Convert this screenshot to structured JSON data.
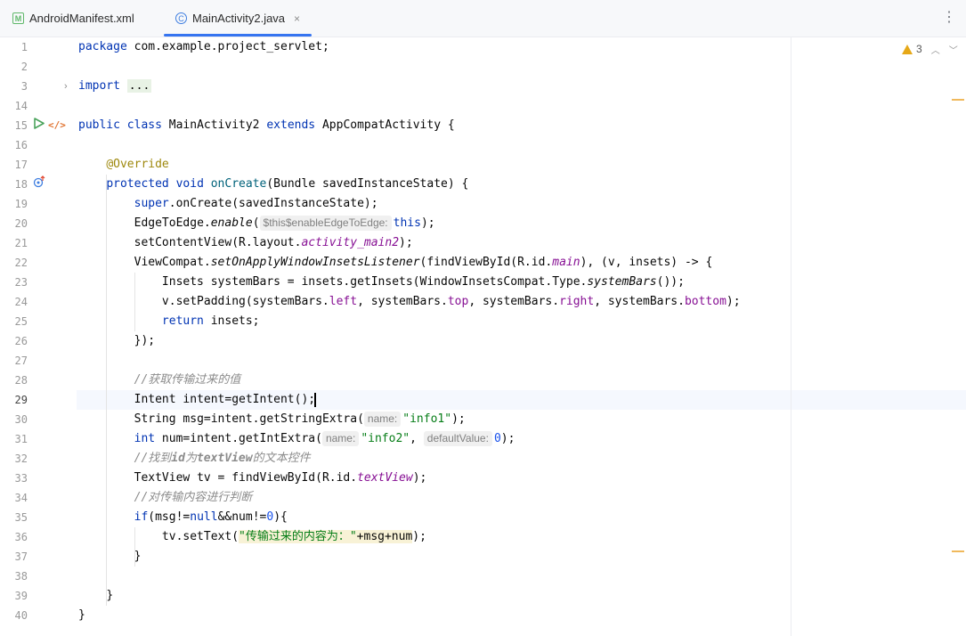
{
  "tabs": [
    {
      "label": "AndroidManifest.xml",
      "icon": "xml-file-icon",
      "active": false
    },
    {
      "label": "MainActivity2.java",
      "icon": "java-class-icon",
      "active": true,
      "close": "×"
    }
  ],
  "menu_glyph": "⋮",
  "inspection": {
    "warning_count": "3"
  },
  "colors": {
    "accent": "#3574f0",
    "keyword": "#0033b3",
    "string": "#067d17",
    "annotation": "#9e880d",
    "comment": "#8c8c8c",
    "field": "#871094"
  },
  "gutter": {
    "line_numbers": [
      "1",
      "2",
      "3",
      "14",
      "15",
      "16",
      "17",
      "18",
      "19",
      "20",
      "21",
      "22",
      "23",
      "24",
      "25",
      "26",
      "27",
      "28",
      "29",
      "30",
      "31",
      "32",
      "33",
      "34",
      "35",
      "36",
      "37",
      "38",
      "39",
      "40"
    ],
    "current_line": "29"
  },
  "code": {
    "l1_package": "package",
    "l1_name": " com.example.project_servlet;",
    "l3_import": "import",
    "l3_folded": "...",
    "l15_public": "public",
    "l15_class": "class",
    "l15_name": " MainActivity2 ",
    "l15_extends": "extends",
    "l15_super": " AppCompatActivity {",
    "l17_annotation": "@Override",
    "l18_protected": "protected",
    "l18_void": "void",
    "l18_method": "onCreate",
    "l18_params": "(Bundle savedInstanceState) {",
    "l19_super": "super",
    "l19_rest": ".onCreate(savedInstanceState);",
    "l20_a": "EdgeToEdge.",
    "l20_enable": "enable",
    "l20_paren": "(",
    "l20_hint": "$this$enableEdgeToEdge:",
    "l20_this": "this",
    "l20_end": ");",
    "l21_a": "setContentView(R.layout.",
    "l21_field": "activity_main2",
    "l21_end": ");",
    "l22_a": "ViewCompat.",
    "l22_method": "setOnApplyWindowInsetsListener",
    "l22_b": "(findViewById(R.id.",
    "l22_field": "main",
    "l22_c": "), (v, insets) -> {",
    "l23_a": "Insets systemBars = insets.getInsets(WindowInsetsCompat.Type.",
    "l23_method": "systemBars",
    "l23_end": "());",
    "l24_a": "v.setPadding(systemBars.",
    "l24_left": "left",
    "l24_b": ", systemBars.",
    "l24_top": "top",
    "l24_c": ", systemBars.",
    "l24_right": "right",
    "l24_d": ", systemBars.",
    "l24_bottom": "bottom",
    "l24_end": ");",
    "l25_return": "return",
    "l25_rest": " insets;",
    "l26": "});",
    "l28_comment": "//获取传输过来的值",
    "l29": "Intent intent=getIntent();",
    "l30_a": "String msg=intent.getStringExtra(",
    "l30_hint": "name:",
    "l30_str": "\"info1\"",
    "l30_end": ");",
    "l31_int": "int",
    "l31_a": " num=intent.getIntExtra(",
    "l31_hint1": "name:",
    "l31_str": "\"info2\"",
    "l31_comma": ", ",
    "l31_hint2": "defaultValue:",
    "l31_num": "0",
    "l31_end": ");",
    "l32_a": "//找到",
    "l32_b": "id",
    "l32_c": "为",
    "l32_d": "textView",
    "l32_e": "的文本控件",
    "l33_a": "TextView tv = findViewById(R.id.",
    "l33_field": "textView",
    "l33_end": ");",
    "l34_comment": "//对传输内容进行判断",
    "l35_if": "if",
    "l35_a": "(msg!=",
    "l35_null": "null",
    "l35_b": "&&num!=",
    "l35_num": "0",
    "l35_c": "){",
    "l36_a": "tv.setText(",
    "l36_str": "\"传输过来的内容为：\"",
    "l36_b": "+msg+num",
    "l36_end": ");",
    "l37": "}",
    "l39": "}",
    "l40": "}"
  }
}
